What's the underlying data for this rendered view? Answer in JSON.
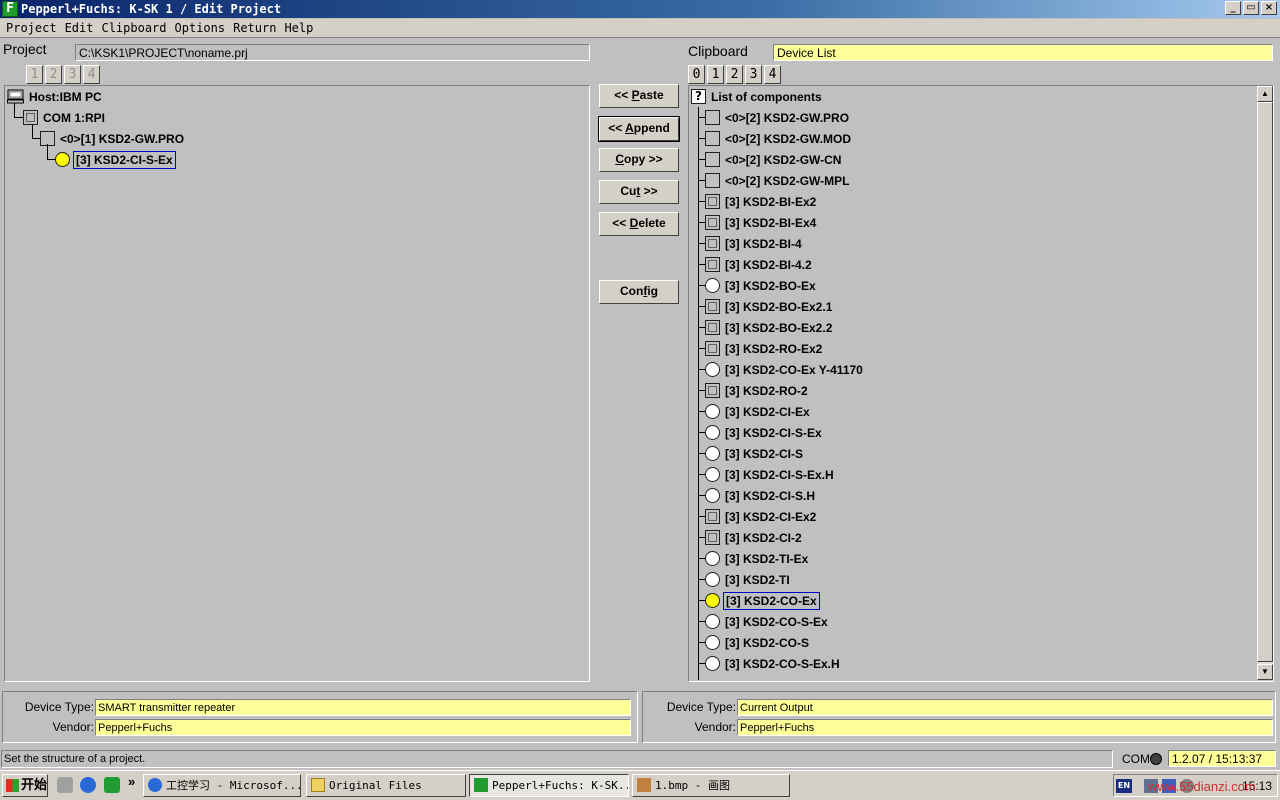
{
  "window": {
    "title": "Pepperl+Fuchs: K-SK 1 / Edit Project",
    "app_icon_glyph": "F",
    "controls": [
      "_",
      "▭",
      "×"
    ]
  },
  "menu": [
    "Project",
    "Edit",
    "Clipboard",
    "Options",
    "Return",
    "Help"
  ],
  "project": {
    "label": "Project",
    "path": "C:\\KSK1\\PROJECT\\noname.prj",
    "tabs": [
      "1",
      "2",
      "3",
      "4"
    ],
    "tree": [
      {
        "label": "Host:IBM PC",
        "icon": "computer-icon"
      },
      {
        "label": "COM 1:RPI",
        "icon": "square-module-icon"
      },
      {
        "label": "<0>[1] KSD2-GW.PRO",
        "icon": "grid-module-icon"
      },
      {
        "label": "[3] KSD2-CI-S-Ex",
        "icon": "circle-module-icon",
        "selected": true
      }
    ]
  },
  "buttons": {
    "paste_pre": "<< ",
    "paste_key": "P",
    "paste_post": "aste",
    "append_pre": "<< ",
    "append_key": "A",
    "append_post": "ppend",
    "copy_key": "C",
    "copy_post": "opy >>",
    "cut_pre": "Cu",
    "cut_key": "t",
    "cut_post": " >>",
    "delete_pre": "<< ",
    "delete_key": "D",
    "delete_post": "elete",
    "config_pre": "Con",
    "config_key": "f",
    "config_post": "ig"
  },
  "clipboard": {
    "label": "Clipboard",
    "field_value": "Device List",
    "tabs": [
      "0",
      "1",
      "2",
      "3",
      "4"
    ],
    "list_header": "List of components",
    "items": [
      {
        "label": "<0>[2] KSD2-GW.PRO",
        "icon": "grid"
      },
      {
        "label": "<0>[2] KSD2-GW.MOD",
        "icon": "grid"
      },
      {
        "label": "<0>[2] KSD2-GW-CN",
        "icon": "grid"
      },
      {
        "label": "<0>[2] KSD2-GW-MPL",
        "icon": "grid"
      },
      {
        "label": "[3] KSD2-BI-Ex2",
        "icon": "square"
      },
      {
        "label": "[3] KSD2-BI-Ex4",
        "icon": "square"
      },
      {
        "label": "[3] KSD2-BI-4",
        "icon": "square"
      },
      {
        "label": "[3] KSD2-BI-4.2",
        "icon": "square"
      },
      {
        "label": "[3] KSD2-BO-Ex",
        "icon": "circle"
      },
      {
        "label": "[3] KSD2-BO-Ex2.1",
        "icon": "square"
      },
      {
        "label": "[3] KSD2-BO-Ex2.2",
        "icon": "square"
      },
      {
        "label": "[3] KSD2-RO-Ex2",
        "icon": "square"
      },
      {
        "label": "[3] KSD2-CO-Ex Y-41170",
        "icon": "circle"
      },
      {
        "label": "[3] KSD2-RO-2",
        "icon": "square"
      },
      {
        "label": "[3] KSD2-CI-Ex",
        "icon": "circle"
      },
      {
        "label": "[3] KSD2-CI-S-Ex",
        "icon": "circle"
      },
      {
        "label": "[3] KSD2-CI-S",
        "icon": "circle"
      },
      {
        "label": "[3] KSD2-CI-S-Ex.H",
        "icon": "circle"
      },
      {
        "label": "[3] KSD2-CI-S.H",
        "icon": "circle"
      },
      {
        "label": "[3] KSD2-CI-Ex2",
        "icon": "square"
      },
      {
        "label": "[3] KSD2-CI-2",
        "icon": "square"
      },
      {
        "label": "[3] KSD2-TI-Ex",
        "icon": "circle"
      },
      {
        "label": "[3] KSD2-TI",
        "icon": "circle"
      },
      {
        "label": "[3] KSD2-CO-Ex",
        "icon": "circle",
        "selected": true
      },
      {
        "label": "[3] KSD2-CO-S-Ex",
        "icon": "circle"
      },
      {
        "label": "[3] KSD2-CO-S",
        "icon": "circle"
      },
      {
        "label": "[3] KSD2-CO-S-Ex.H",
        "icon": "circle"
      }
    ]
  },
  "info_left": {
    "device_type_label": "Device Type:",
    "device_type": "SMART transmitter repeater",
    "vendor_label": "Vendor:",
    "vendor": "Pepperl+Fuchs"
  },
  "info_right": {
    "device_type_label": "Device Type:",
    "device_type": "Current Output",
    "vendor_label": "Vendor:",
    "vendor": "Pepperl+Fuchs"
  },
  "status": {
    "text": "Set the structure of a project.",
    "com_label": "COM",
    "version": "1.2.07 / 15:13:37"
  },
  "taskbar": {
    "start": "开始",
    "overflow": "»",
    "tasks": [
      {
        "label": "工控学习 - Microsof...",
        "icon": "ie-icon"
      },
      {
        "label": "Original Files",
        "icon": "folder-icon"
      },
      {
        "label": "Pepperl+Fuchs: K-SK...",
        "icon": "pf-icon",
        "active": true
      },
      {
        "label": "1.bmp - 画图",
        "icon": "paint-icon"
      }
    ],
    "tray_lang": "EN",
    "clock": "15:13"
  },
  "watermark": "www.55dianzi.com",
  "colors": {
    "highlight_field": "#ffff99",
    "selected_node": "#ffff00",
    "window_bg": "#c0c0c0",
    "title_gradient_start": "#0a246a"
  }
}
